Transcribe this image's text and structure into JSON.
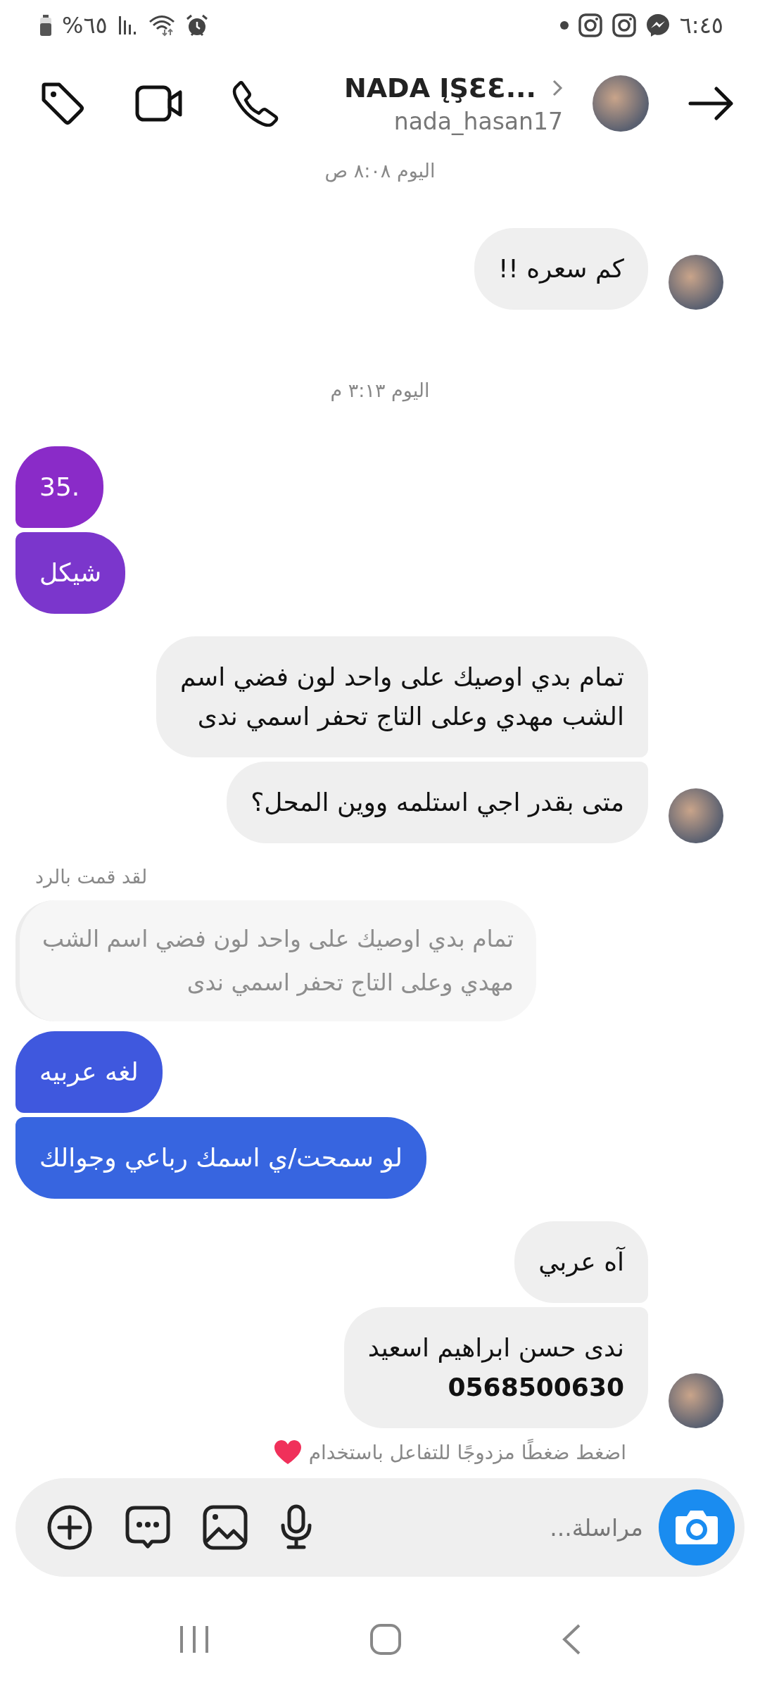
{
  "status_bar": {
    "battery": "%٦٥",
    "time": "٦:٤٥"
  },
  "header": {
    "name": "NADA ĮŞƐƐ...",
    "username": "nada_hasan17"
  },
  "thread": [
    {
      "kind": "timestamp",
      "text": "اليوم ٨:٠٨ ص"
    },
    {
      "kind": "received",
      "messages": [
        {
          "text": "كم سعره !!"
        }
      ]
    },
    {
      "kind": "timestamp",
      "text": "اليوم ٣:١٣ م"
    },
    {
      "kind": "sent",
      "messages": [
        {
          "text": "35.",
          "color": "#8a2bc8"
        },
        {
          "text": "شيكل",
          "color": "#7b36cc"
        }
      ]
    },
    {
      "kind": "received",
      "messages": [
        {
          "text": "تمام بدي اوصيك على واحد لون فضي اسم\nالشب مهدي وعلى التاج تحفر اسمي ندى"
        },
        {
          "text": "متى بقدر اجي استلمه ووين المحل؟"
        }
      ]
    },
    {
      "kind": "reply_note",
      "text": "لقد قمت بالرد"
    },
    {
      "kind": "quote",
      "text": "تمام بدي اوصيك على واحد لون فضي اسم الشب\nمهدي وعلى التاج تحفر اسمي ندى"
    },
    {
      "kind": "sent",
      "messages": [
        {
          "text": "لغه عربيه",
          "color": "#3f58de"
        },
        {
          "text": "لو سمحت/ي اسمك رباعي وجوالك",
          "color": "#3765e0"
        }
      ]
    },
    {
      "kind": "received",
      "messages": [
        {
          "text": "آه عربي"
        },
        {
          "text": "ندى حسن ابراهيم اسعيد\n**0568500630**"
        }
      ]
    },
    {
      "kind": "hint",
      "text": "اضغط ضغطًا مزدوجًا للتفاعل باستخدام"
    }
  ],
  "composer": {
    "placeholder": "مراسلة..."
  }
}
